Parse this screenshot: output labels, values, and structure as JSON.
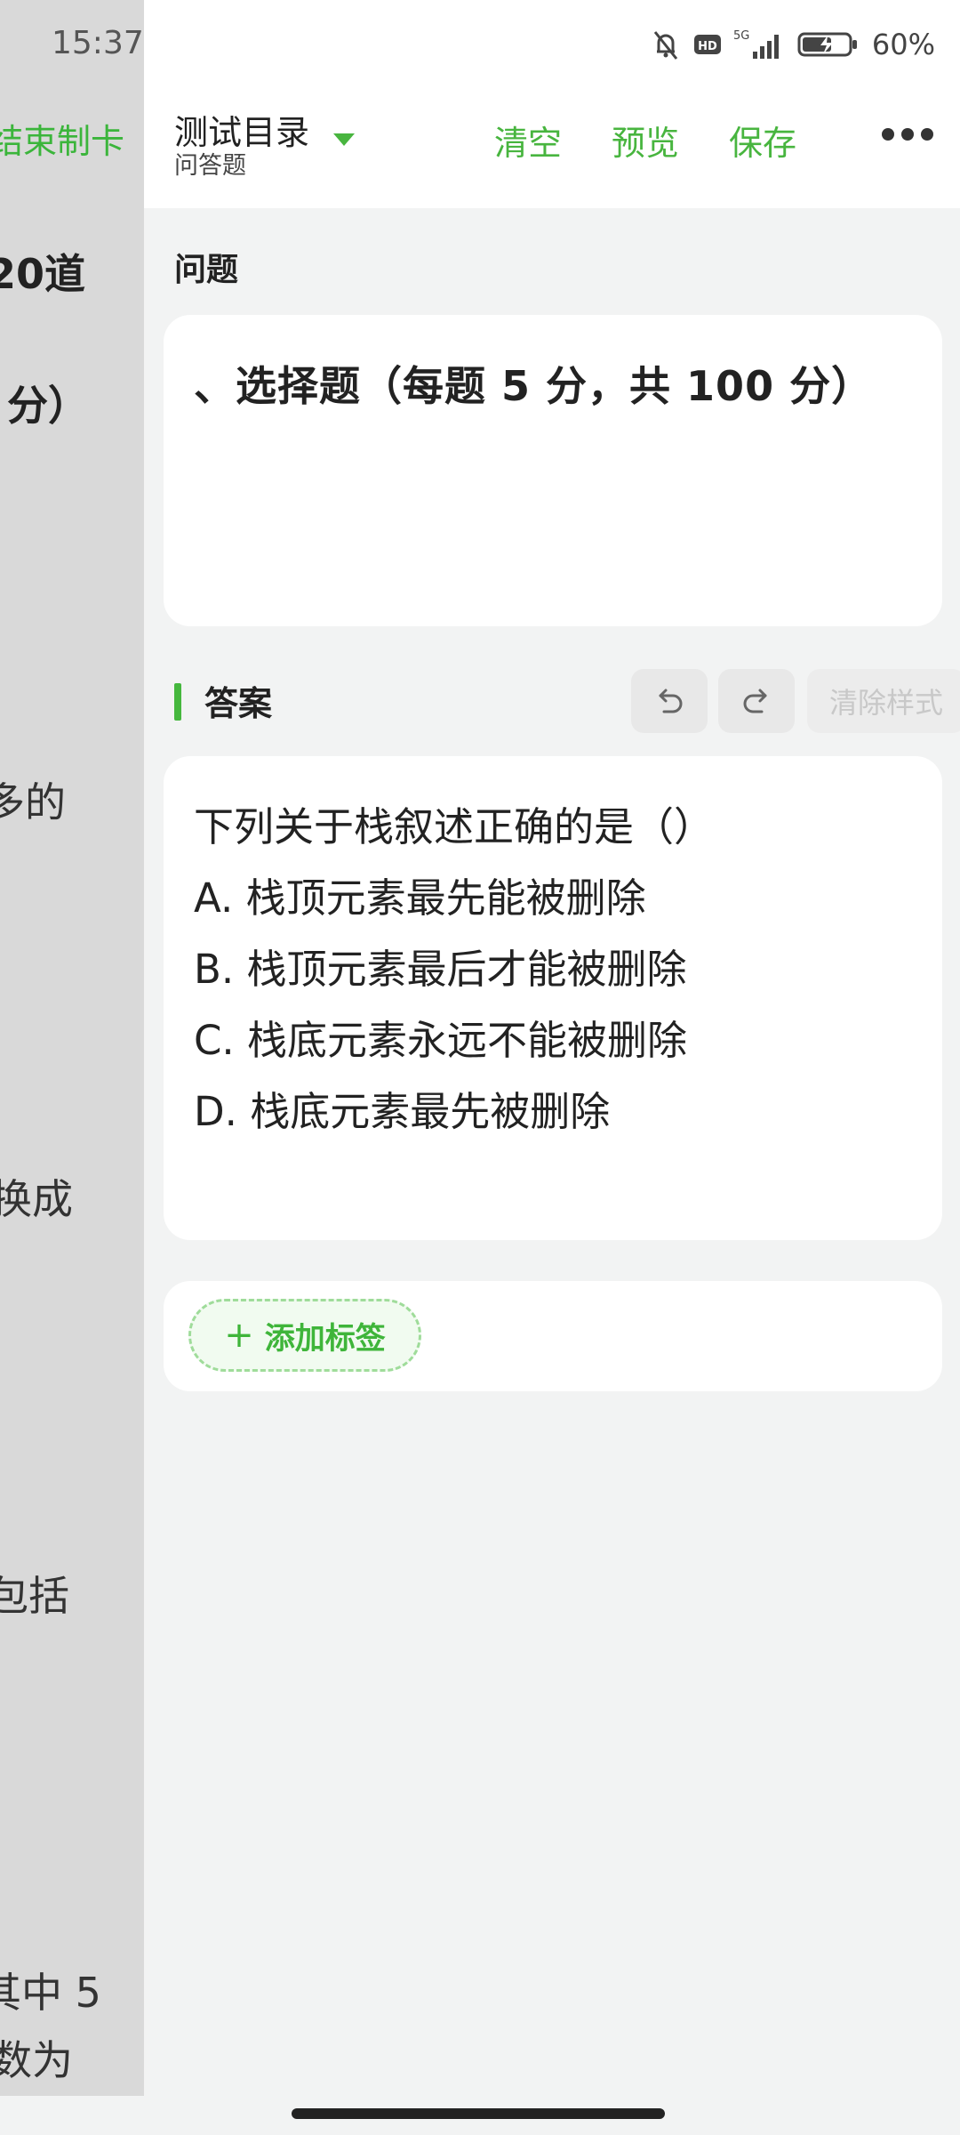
{
  "status_bar": {
    "time": "15:37",
    "battery": "60%",
    "network": "5G",
    "hd": "HD"
  },
  "left_panel": {
    "items": [
      "结束制卡",
      "20道",
      "分）",
      "多的",
      "换成",
      "包括",
      "其中 5",
      "数为"
    ]
  },
  "header": {
    "directory_title": "测试目录",
    "directory_subtitle": "问答题",
    "actions": {
      "clear": "清空",
      "preview": "预览",
      "save": "保存"
    }
  },
  "question": {
    "label": "问题",
    "text": "、选择题（每题 5 分，共 100 分）"
  },
  "answer": {
    "label": "答案",
    "clear_style": "清除样式",
    "lines": [
      "下列关于栈叙述正确的是（）",
      "A. 栈顶元素最先能被删除",
      "B. 栈顶元素最后才能被删除",
      "C. 栈底元素永远不能被删除",
      "D. 栈底元素最先被删除"
    ]
  },
  "tags": {
    "add_label": "添加标签"
  },
  "colors": {
    "accent": "#48b53f",
    "background": "#f2f3f3"
  }
}
